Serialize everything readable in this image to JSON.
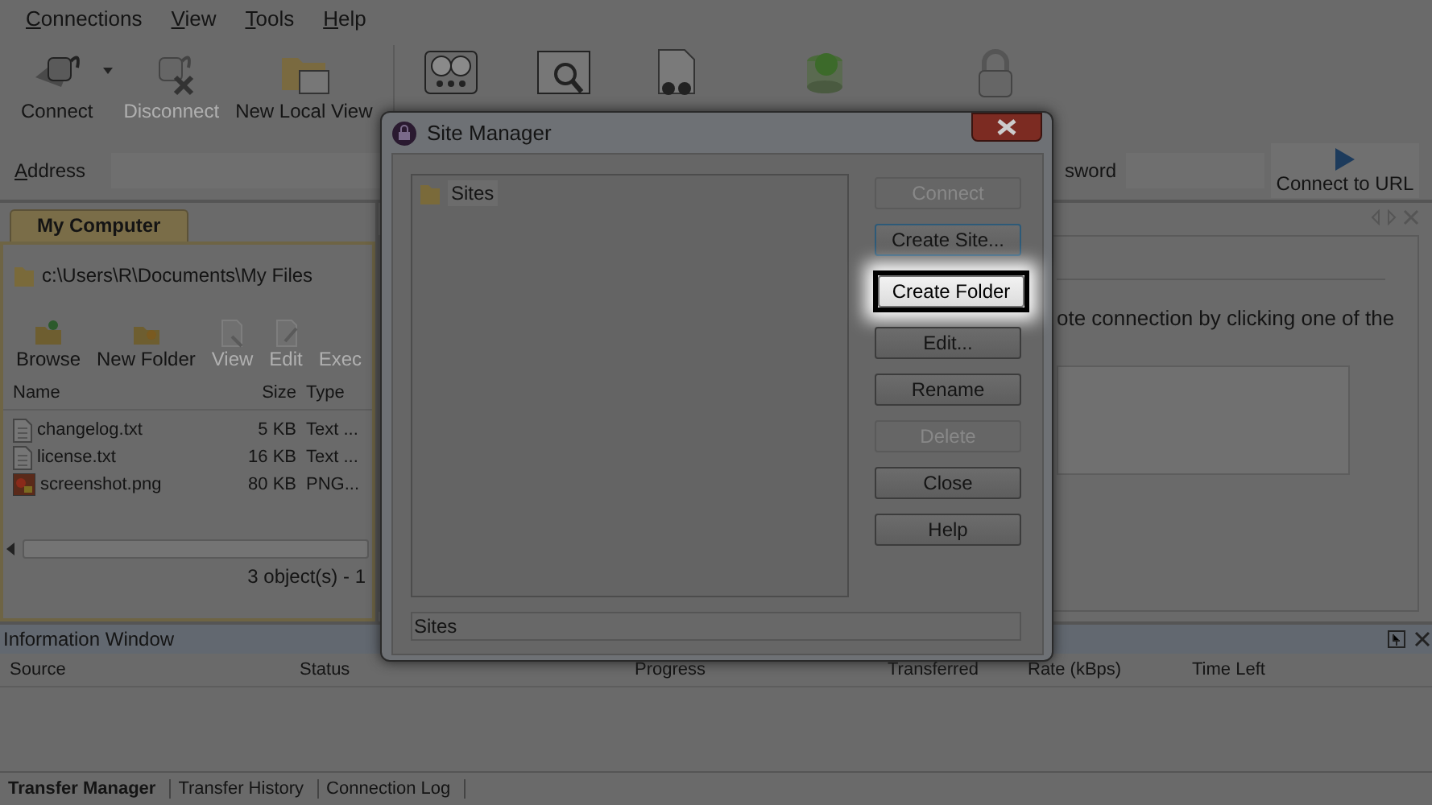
{
  "menu": [
    {
      "label": "Connections"
    },
    {
      "label": "View"
    },
    {
      "label": "Tools"
    },
    {
      "label": "Help"
    }
  ],
  "toolbar": [
    {
      "label": "Connect",
      "disabled": false,
      "dropdown": true
    },
    {
      "label": "Disconnect",
      "disabled": true,
      "dropdown": false
    },
    {
      "label": "New Local View",
      "disabled": false,
      "dropdown": false
    }
  ],
  "address_bar": {
    "label": "Address",
    "password_label": "sword",
    "connect_button": "Connect to URL"
  },
  "local_panel": {
    "tab": {
      "label": "My Computer",
      "selected": true
    },
    "path": "c:\\Users\\R\\Documents\\My Files",
    "tools": [
      {
        "label": "Browse",
        "disabled": false
      },
      {
        "label": "New Folder",
        "disabled": false
      },
      {
        "label": "View",
        "disabled": true
      },
      {
        "label": "Edit",
        "disabled": true
      },
      {
        "label": "Exec",
        "disabled": true
      }
    ],
    "columns": [
      "Name",
      "Size",
      "Type"
    ],
    "rows": [
      {
        "kind": "text",
        "name": "changelog.txt",
        "size": "5 KB",
        "type": "Text ..."
      },
      {
        "kind": "text",
        "name": "license.txt",
        "size": "16 KB",
        "type": "Text ..."
      },
      {
        "kind": "image",
        "name": "screenshot.png",
        "size": "80 KB",
        "type": "PNG..."
      }
    ],
    "status": "3 object(s) - 1"
  },
  "remote_panel": {
    "message": "ote connection by clicking one of the"
  },
  "information_window": {
    "title": "Information Window",
    "columns": [
      "Source",
      "Status",
      "Progress",
      "Transferred",
      "Rate (kBps)",
      "Time Left"
    ],
    "tabs": [
      {
        "label": "Transfer Manager",
        "selected": true
      },
      {
        "label": "Transfer History",
        "selected": false
      },
      {
        "label": "Connection Log",
        "selected": false
      }
    ]
  },
  "site_manager": {
    "title": "Site Manager",
    "tree": [
      {
        "label": "Sites"
      }
    ],
    "status": "Sites",
    "buttons": [
      {
        "label": "Connect",
        "disabled": true,
        "default": false,
        "highlighted": false
      },
      {
        "label": "Create Site...",
        "disabled": false,
        "default": true,
        "highlighted": false
      },
      {
        "label": "Create Folder",
        "disabled": false,
        "default": false,
        "highlighted": true
      },
      {
        "label": "Edit...",
        "disabled": false,
        "default": false,
        "highlighted": false
      },
      {
        "label": "Rename",
        "disabled": false,
        "default": false,
        "highlighted": false
      },
      {
        "label": "Delete",
        "disabled": true,
        "default": false,
        "highlighted": false
      },
      {
        "label": "Close",
        "disabled": false,
        "default": false,
        "highlighted": false
      },
      {
        "label": "Help",
        "disabled": false,
        "default": false,
        "highlighted": false
      }
    ]
  }
}
